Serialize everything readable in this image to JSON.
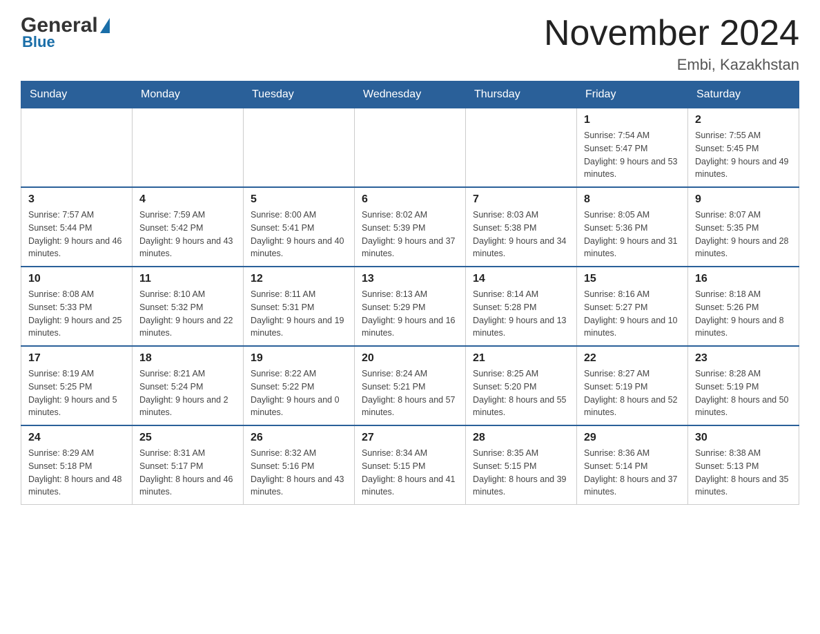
{
  "logo": {
    "general": "General",
    "blue": "Blue"
  },
  "title": "November 2024",
  "location": "Embi, Kazakhstan",
  "weekdays": [
    "Sunday",
    "Monday",
    "Tuesday",
    "Wednesday",
    "Thursday",
    "Friday",
    "Saturday"
  ],
  "weeks": [
    [
      {
        "day": "",
        "info": ""
      },
      {
        "day": "",
        "info": ""
      },
      {
        "day": "",
        "info": ""
      },
      {
        "day": "",
        "info": ""
      },
      {
        "day": "",
        "info": ""
      },
      {
        "day": "1",
        "info": "Sunrise: 7:54 AM\nSunset: 5:47 PM\nDaylight: 9 hours and 53 minutes."
      },
      {
        "day": "2",
        "info": "Sunrise: 7:55 AM\nSunset: 5:45 PM\nDaylight: 9 hours and 49 minutes."
      }
    ],
    [
      {
        "day": "3",
        "info": "Sunrise: 7:57 AM\nSunset: 5:44 PM\nDaylight: 9 hours and 46 minutes."
      },
      {
        "day": "4",
        "info": "Sunrise: 7:59 AM\nSunset: 5:42 PM\nDaylight: 9 hours and 43 minutes."
      },
      {
        "day": "5",
        "info": "Sunrise: 8:00 AM\nSunset: 5:41 PM\nDaylight: 9 hours and 40 minutes."
      },
      {
        "day": "6",
        "info": "Sunrise: 8:02 AM\nSunset: 5:39 PM\nDaylight: 9 hours and 37 minutes."
      },
      {
        "day": "7",
        "info": "Sunrise: 8:03 AM\nSunset: 5:38 PM\nDaylight: 9 hours and 34 minutes."
      },
      {
        "day": "8",
        "info": "Sunrise: 8:05 AM\nSunset: 5:36 PM\nDaylight: 9 hours and 31 minutes."
      },
      {
        "day": "9",
        "info": "Sunrise: 8:07 AM\nSunset: 5:35 PM\nDaylight: 9 hours and 28 minutes."
      }
    ],
    [
      {
        "day": "10",
        "info": "Sunrise: 8:08 AM\nSunset: 5:33 PM\nDaylight: 9 hours and 25 minutes."
      },
      {
        "day": "11",
        "info": "Sunrise: 8:10 AM\nSunset: 5:32 PM\nDaylight: 9 hours and 22 minutes."
      },
      {
        "day": "12",
        "info": "Sunrise: 8:11 AM\nSunset: 5:31 PM\nDaylight: 9 hours and 19 minutes."
      },
      {
        "day": "13",
        "info": "Sunrise: 8:13 AM\nSunset: 5:29 PM\nDaylight: 9 hours and 16 minutes."
      },
      {
        "day": "14",
        "info": "Sunrise: 8:14 AM\nSunset: 5:28 PM\nDaylight: 9 hours and 13 minutes."
      },
      {
        "day": "15",
        "info": "Sunrise: 8:16 AM\nSunset: 5:27 PM\nDaylight: 9 hours and 10 minutes."
      },
      {
        "day": "16",
        "info": "Sunrise: 8:18 AM\nSunset: 5:26 PM\nDaylight: 9 hours and 8 minutes."
      }
    ],
    [
      {
        "day": "17",
        "info": "Sunrise: 8:19 AM\nSunset: 5:25 PM\nDaylight: 9 hours and 5 minutes."
      },
      {
        "day": "18",
        "info": "Sunrise: 8:21 AM\nSunset: 5:24 PM\nDaylight: 9 hours and 2 minutes."
      },
      {
        "day": "19",
        "info": "Sunrise: 8:22 AM\nSunset: 5:22 PM\nDaylight: 9 hours and 0 minutes."
      },
      {
        "day": "20",
        "info": "Sunrise: 8:24 AM\nSunset: 5:21 PM\nDaylight: 8 hours and 57 minutes."
      },
      {
        "day": "21",
        "info": "Sunrise: 8:25 AM\nSunset: 5:20 PM\nDaylight: 8 hours and 55 minutes."
      },
      {
        "day": "22",
        "info": "Sunrise: 8:27 AM\nSunset: 5:19 PM\nDaylight: 8 hours and 52 minutes."
      },
      {
        "day": "23",
        "info": "Sunrise: 8:28 AM\nSunset: 5:19 PM\nDaylight: 8 hours and 50 minutes."
      }
    ],
    [
      {
        "day": "24",
        "info": "Sunrise: 8:29 AM\nSunset: 5:18 PM\nDaylight: 8 hours and 48 minutes."
      },
      {
        "day": "25",
        "info": "Sunrise: 8:31 AM\nSunset: 5:17 PM\nDaylight: 8 hours and 46 minutes."
      },
      {
        "day": "26",
        "info": "Sunrise: 8:32 AM\nSunset: 5:16 PM\nDaylight: 8 hours and 43 minutes."
      },
      {
        "day": "27",
        "info": "Sunrise: 8:34 AM\nSunset: 5:15 PM\nDaylight: 8 hours and 41 minutes."
      },
      {
        "day": "28",
        "info": "Sunrise: 8:35 AM\nSunset: 5:15 PM\nDaylight: 8 hours and 39 minutes."
      },
      {
        "day": "29",
        "info": "Sunrise: 8:36 AM\nSunset: 5:14 PM\nDaylight: 8 hours and 37 minutes."
      },
      {
        "day": "30",
        "info": "Sunrise: 8:38 AM\nSunset: 5:13 PM\nDaylight: 8 hours and 35 minutes."
      }
    ]
  ]
}
